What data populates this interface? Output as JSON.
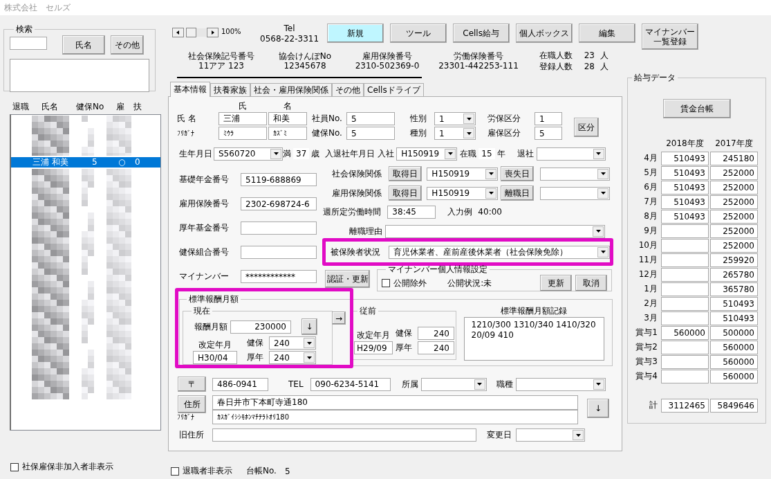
{
  "window": {
    "title": "株式会社　セルズ"
  },
  "search": {
    "legend": "検索",
    "buttons": [
      "氏名",
      "その他"
    ]
  },
  "employee_list": {
    "columns": [
      "退職",
      "氏名",
      "健保No",
      "雇",
      "扶"
    ],
    "rows": [
      {
        "name": "三浦 和美",
        "kenpo_no": "5",
        "koyo": "○",
        "fuyo": "0",
        "selected": true
      }
    ]
  },
  "hide_uninsured": {
    "label": "社保雇保非加入者非表示",
    "checked": false
  },
  "toolbar": {
    "zoom": "100%",
    "tel_label": "Tel",
    "tel": "0568-22-3311",
    "buttons": [
      {
        "label": "新規",
        "highlighted": true
      },
      {
        "label": "ツール",
        "highlighted": false
      },
      {
        "label": "Cells給与",
        "highlighted": false
      },
      {
        "label": "個人ボックス",
        "highlighted": false
      },
      {
        "label": "編集",
        "highlighted": false
      },
      {
        "label": "マイナンバー一覧登録",
        "highlighted": false
      }
    ]
  },
  "company_numbers": [
    {
      "label": "社会保険記号番号",
      "value": "11アア 123"
    },
    {
      "label": "協会けんぽNo",
      "value": "12345678"
    },
    {
      "label": "雇用保険番号",
      "value": "2310-502369-0"
    },
    {
      "label": "労働保険番号",
      "value": "23301-442253-111"
    }
  ],
  "headcounts": [
    {
      "label": "在職人数",
      "value": "23",
      "unit": "人"
    },
    {
      "label": "登録人数",
      "value": "28",
      "unit": "人"
    }
  ],
  "tabs": [
    {
      "label": "基本情報",
      "selected": true
    },
    {
      "label": "扶養家族",
      "selected": false
    },
    {
      "label": "社会・雇用保険関係",
      "selected": false
    },
    {
      "label": "その他",
      "selected": false
    },
    {
      "label": "Cellsドライブ",
      "selected": false
    }
  ],
  "basic": {
    "name": {
      "header_family": "氏",
      "header_given": "名",
      "label": "氏 名",
      "family": "三浦",
      "given": "和美",
      "kana_label": "ﾌﾘｶﾞﾅ",
      "kana_family": "ﾐｳﾗ",
      "kana_given": "ｶｽﾞﾐ"
    },
    "numbers": [
      {
        "label": "社員No.",
        "value": "5"
      },
      {
        "label": "健保No.",
        "value": "5"
      }
    ],
    "codes": [
      {
        "label": "性別",
        "value": "1"
      },
      {
        "label": "種別",
        "value": "1"
      }
    ],
    "divisions": [
      {
        "label": "労保区分",
        "value": "1"
      },
      {
        "label": "雇保区分",
        "value": "5"
      }
    ],
    "division_button": "区分",
    "dates": {
      "birth_label": "生年月日",
      "birth": "S560720",
      "age_prefix": "満",
      "age": "37",
      "age_unit": "歳",
      "join_label": "入退社年月日",
      "join_prefix": "入社",
      "join": "H150919",
      "tenure_prefix": "在職",
      "tenure": "15",
      "tenure_unit": "年",
      "leave_label": "退社"
    },
    "id_fields": [
      {
        "label": "基礎年金番号",
        "value": "5119-688869"
      },
      {
        "label": "雇用保険番号",
        "value": "2302-698724-6"
      },
      {
        "label": "厚年基金番号"
      },
      {
        "label": "健保組合番号"
      },
      {
        "label": "マイナンバー",
        "value": "************"
      }
    ],
    "insurance": [
      {
        "label": "社会保険関係",
        "acquire_button": "取得日",
        "acquire_date": "H150919",
        "loss_button": "喪失日"
      },
      {
        "label": "雇用保険関係",
        "acquire_button": "取得日",
        "acquire_date": "H150919",
        "loss_button": "離職日"
      }
    ],
    "weekly_hours": {
      "label": "週所定労働時間",
      "value": "38:45",
      "hint_label": "入力例",
      "hint_value": "40:00"
    },
    "separation_reason": {
      "label": "離職理由"
    },
    "insured_status": {
      "label": "被保険者状況",
      "value": "育児休業者、産前産後休業者（社会保険免除）"
    },
    "mynumber_button": "認証・更新",
    "mynumber_settings": {
      "legend": "マイナンバー個人情報設定",
      "exclude": {
        "label": "公開除外",
        "checked": false
      },
      "status": "公開状況:未",
      "buttons": [
        "更新",
        "取消"
      ]
    },
    "remuneration": {
      "legend": "標準報酬月額",
      "current": {
        "legend": "現在",
        "amount_label": "報酬月額",
        "amount": "230000",
        "down_button": "↓",
        "revision_label": "改定年月",
        "revision": "H30/04",
        "kenpo_label": "健保",
        "kenpo": "240",
        "kounen_label": "厚年",
        "kounen": "240"
      },
      "copy_button": "→",
      "previous": {
        "legend": "従前",
        "revision_label": "改定年月",
        "revision": "H29/09",
        "kenpo_label": "健保",
        "kenpo": "240",
        "kounen_label": "厚年",
        "kounen": "240"
      },
      "record": {
        "label": "標準報酬月額記録",
        "text": "1210/300 1310/340 1410/320 20/09 410"
      }
    },
    "address": {
      "postal_button": "〒",
      "postal": "486-0941",
      "tel_label": "TEL",
      "tel": "090-6234-5141",
      "affiliation_label": "所属",
      "job_label": "職種",
      "address_button": "住所",
      "kana_label": "ﾌﾘｶﾞﾅ",
      "address": "春日井市下本町寺通180",
      "address_kana": "ｶｽｶﾞｲｼｼﾓﾎﾝﾏﾁﾃﾗﾄｵﾘ180",
      "down_button": "↓",
      "old_label": "旧住所",
      "changed_label": "変更日"
    }
  },
  "footer": {
    "hide_retired": {
      "label": "退職者非表示",
      "checked": false
    },
    "ledger_label": "台帳No.",
    "ledger_no": "5"
  },
  "pay_data": {
    "legend": "給与データ",
    "ledger_button": "賃金台帳",
    "years": [
      "2018年度",
      "2017年度"
    ],
    "rows": [
      {
        "label": "4月",
        "current_year": "510493",
        "previous_year": "245180"
      },
      {
        "label": "5月",
        "current_year": "510493",
        "previous_year": "252000"
      },
      {
        "label": "6月",
        "current_year": "510493",
        "previous_year": "252000"
      },
      {
        "label": "7月",
        "current_year": "510493",
        "previous_year": "252000"
      },
      {
        "label": "8月",
        "current_year": "510493",
        "previous_year": "252000"
      },
      {
        "label": "9月",
        "previous_year": "252000"
      },
      {
        "label": "10月",
        "previous_year": "252000"
      },
      {
        "label": "11月",
        "previous_year": "259920"
      },
      {
        "label": "12月",
        "previous_year": "265780"
      },
      {
        "label": "1月",
        "previous_year": "365780"
      },
      {
        "label": "2月",
        "previous_year": "510493"
      },
      {
        "label": "3月",
        "previous_year": "510493"
      },
      {
        "label": "賞与1",
        "current_year": "560000",
        "previous_year": "500000"
      },
      {
        "label": "賞与2",
        "previous_year": "560000"
      },
      {
        "label": "賞与3",
        "previous_year": "560000"
      },
      {
        "label": "賞与4",
        "previous_year": "560000"
      }
    ],
    "total": {
      "label": "計",
      "current_year": "3112465",
      "previous_year": "5849646"
    }
  }
}
